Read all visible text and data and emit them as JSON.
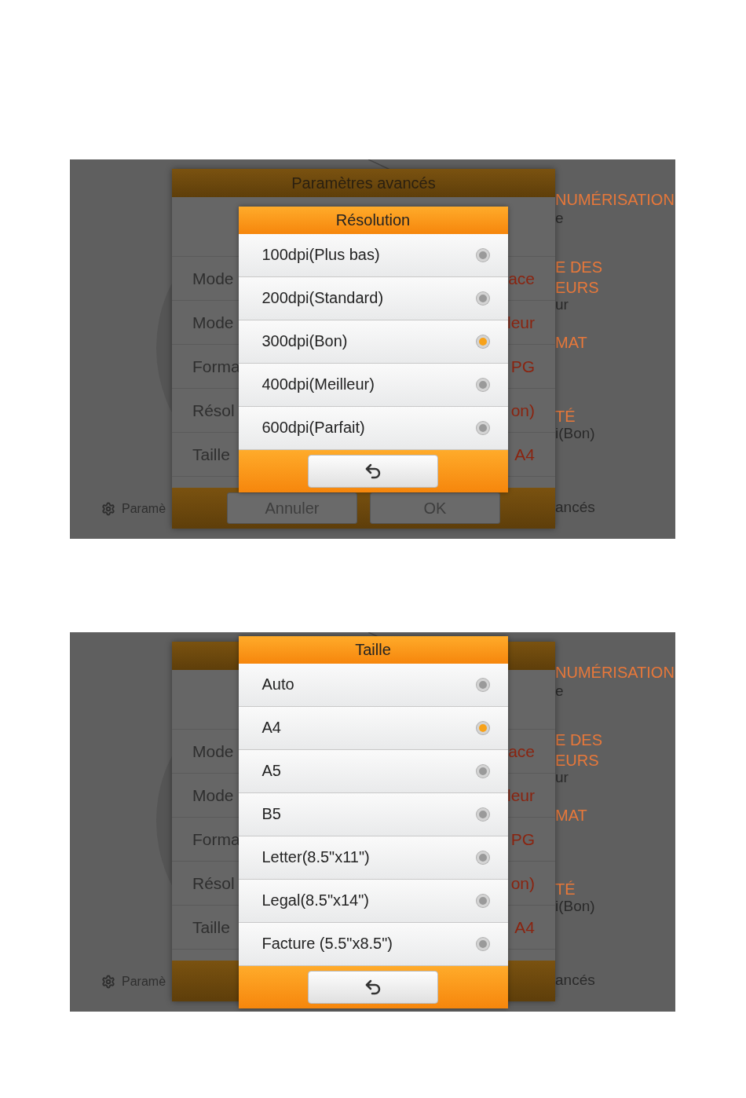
{
  "screens": [
    {
      "background": {
        "left_label": "Paramè",
        "right_texts": [
          {
            "text": "NUMÉRISATION",
            "kind": "heading"
          },
          {
            "text": "e",
            "kind": "sub"
          },
          {
            "text": "E DES",
            "kind": "heading"
          },
          {
            "text": "EURS",
            "kind": "heading"
          },
          {
            "text": "ur",
            "kind": "sub"
          },
          {
            "text": "MAT",
            "kind": "heading"
          },
          {
            "text": "TÉ",
            "kind": "heading"
          },
          {
            "text": "i(Bon)",
            "kind": "sub"
          },
          {
            "text": "ancés",
            "kind": "sub"
          }
        ]
      },
      "settings_dialog": {
        "title": "Paramètres avancés",
        "rows": [
          {
            "label": "Mode",
            "value": "ace"
          },
          {
            "label": "Mode",
            "value": "leur"
          },
          {
            "label": "Forma",
            "value": "PG"
          },
          {
            "label": "Résol",
            "value": "on)"
          },
          {
            "label": "Taille",
            "value": "A4"
          }
        ],
        "buttons": [
          "Annuler",
          "OK"
        ]
      },
      "popup": {
        "title": "Résolution",
        "options": [
          {
            "label": "100dpi(Plus bas)",
            "selected": false
          },
          {
            "label": "200dpi(Standard)",
            "selected": false
          },
          {
            "label": "300dpi(Bon)",
            "selected": true
          },
          {
            "label": "400dpi(Meilleur)",
            "selected": false
          },
          {
            "label": "600dpi(Parfait)",
            "selected": false
          }
        ]
      }
    },
    {
      "background": {
        "left_label": "Paramè",
        "right_texts": [
          {
            "text": "NUMÉRISATION",
            "kind": "heading"
          },
          {
            "text": "e",
            "kind": "sub"
          },
          {
            "text": "E DES",
            "kind": "heading"
          },
          {
            "text": "EURS",
            "kind": "heading"
          },
          {
            "text": "ur",
            "kind": "sub"
          },
          {
            "text": "MAT",
            "kind": "heading"
          },
          {
            "text": "TÉ",
            "kind": "heading"
          },
          {
            "text": "i(Bon)",
            "kind": "sub"
          },
          {
            "text": "ancés",
            "kind": "sub"
          }
        ]
      },
      "settings_dialog": {
        "rows": [
          {
            "label": "Mode",
            "value": "ace"
          },
          {
            "label": "Mode",
            "value": "leur"
          },
          {
            "label": "Forma",
            "value": "PG"
          },
          {
            "label": "Résol",
            "value": "on)"
          },
          {
            "label": "Taille",
            "value": "A4"
          }
        ]
      },
      "popup": {
        "title": "Taille",
        "options": [
          {
            "label": "Auto",
            "selected": false
          },
          {
            "label": "A4",
            "selected": true
          },
          {
            "label": "A5",
            "selected": false
          },
          {
            "label": "B5",
            "selected": false
          },
          {
            "label": "Letter(8.5\"x11\")",
            "selected": false
          },
          {
            "label": "Legal(8.5\"x14\")",
            "selected": false
          },
          {
            "label": "Facture (5.5\"x8.5\")",
            "selected": false
          }
        ]
      }
    }
  ]
}
